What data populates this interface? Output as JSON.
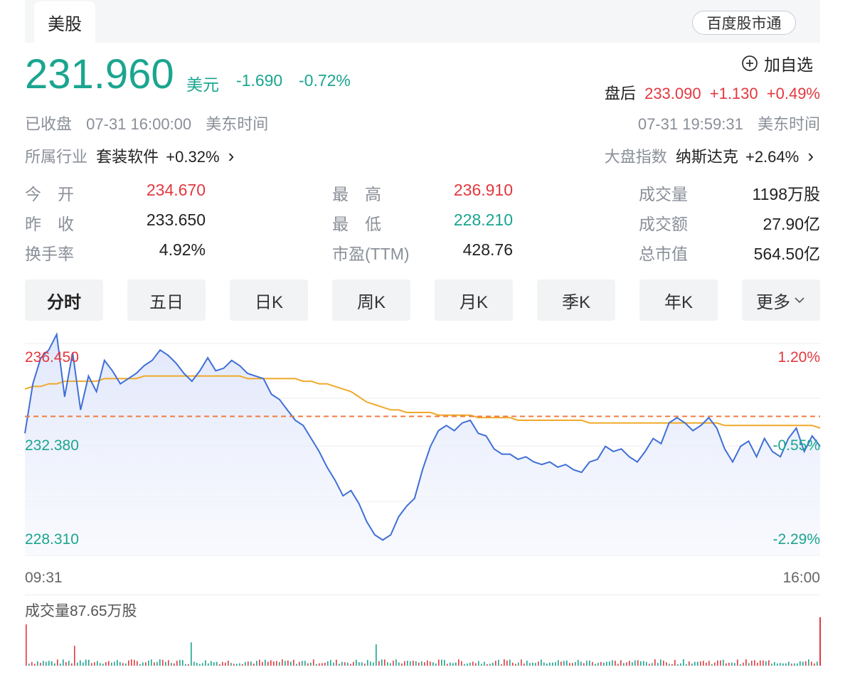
{
  "market_tab": "美股",
  "baidu_button": "百度股市通",
  "quote": {
    "price": "231.960",
    "currency": "美元",
    "change": "-1.690",
    "change_pct": "-0.72%"
  },
  "watchlist": {
    "icon": "plus-circle-icon",
    "label": "加自选"
  },
  "after_hours": {
    "label": "盘后",
    "price": "233.090",
    "change": "+1.130",
    "change_pct": "+0.49%"
  },
  "status": {
    "state": "已收盘",
    "time": "07-31 16:00:00",
    "tz": "美东时间"
  },
  "after_time": {
    "time": "07-31 19:59:31",
    "tz": "美东时间"
  },
  "industry": {
    "label": "所属行业",
    "name": "套装软件",
    "change": "+0.32%",
    "chevron": "›"
  },
  "index": {
    "label": "大盘指数",
    "name": "纳斯达克",
    "change": "+2.64%",
    "chevron": "›"
  },
  "stats": [
    [
      {
        "label": "今　开",
        "value": "234.670",
        "color": "red"
      },
      {
        "label": "最　高",
        "value": "236.910",
        "color": "red"
      },
      {
        "label": "成交量",
        "value": "1198万股",
        "color": "dark"
      }
    ],
    [
      {
        "label": "昨　收",
        "value": "233.650",
        "color": "dark"
      },
      {
        "label": "最　低",
        "value": "228.210",
        "color": "green"
      },
      {
        "label": "成交额",
        "value": "27.90亿",
        "color": "dark"
      }
    ],
    [
      {
        "label": "换手率",
        "value": "4.92%",
        "color": "dark"
      },
      {
        "label": "市盈(TTM)",
        "value": "428.76",
        "color": "dark"
      },
      {
        "label": "总市值",
        "value": "564.50亿",
        "color": "dark"
      }
    ]
  ],
  "periods": [
    "分时",
    "五日",
    "日K",
    "周K",
    "月K",
    "季K",
    "年K",
    "更多"
  ],
  "active_period": "分时",
  "volume_label": "成交量87.65万股",
  "colors": {
    "up": "#e2383f",
    "down": "#1aa58f",
    "price_line": "#3f6fd6",
    "avg_line": "#f0a92a",
    "prev_close": "#f07b3f"
  },
  "chart_data": {
    "type": "line",
    "x_start": "09:31",
    "x_end": "16:00",
    "y_labels": {
      "top": "236.450",
      "mid": "232.380",
      "bottom": "228.310"
    },
    "pct_labels": {
      "top": "1.20%",
      "mid": "-0.55%",
      "bottom": "-2.29%"
    },
    "prev_close": 233.65,
    "ylim": [
      228.31,
      236.45
    ],
    "series": [
      {
        "values": [
          233.0,
          234.9,
          235.9,
          236.2,
          236.8,
          234.4,
          236.1,
          233.9,
          235.2,
          234.6,
          235.8,
          235.4,
          234.9,
          235.1,
          235.3,
          235.6,
          235.8,
          236.2,
          236.0,
          235.7,
          235.3,
          235.0,
          235.4,
          235.9,
          235.4,
          235.5,
          235.8,
          235.6,
          235.3,
          235.2,
          235.1,
          234.5,
          234.3,
          233.9,
          233.5,
          233.3,
          232.8,
          232.3,
          231.7,
          231.2,
          230.6,
          230.8,
          230.3,
          229.6,
          229.1,
          228.9,
          229.1,
          229.8,
          230.2,
          230.5,
          231.6,
          232.5,
          233.1,
          233.3,
          233.1,
          233.4,
          233.5,
          233.0,
          232.9,
          232.4,
          232.2,
          232.2,
          232.0,
          232.1,
          231.9,
          231.8,
          231.9,
          231.7,
          231.8,
          231.6,
          231.5,
          231.9,
          232.0,
          232.5,
          232.3,
          232.4,
          232.1,
          231.9,
          232.3,
          232.8,
          232.6,
          233.4,
          233.6,
          233.4,
          233.1,
          233.3,
          233.6,
          233.2,
          232.4,
          231.9,
          232.5,
          232.7,
          232.1,
          232.8,
          232.3,
          232.1,
          232.8,
          233.2,
          232.3,
          232.9,
          232.5
        ]
      },
      {
        "values": [
          234.7,
          234.8,
          234.8,
          234.9,
          234.9,
          235.0,
          235.0,
          235.0,
          235.0,
          235.0,
          235.1,
          235.1,
          235.1,
          235.1,
          235.1,
          235.2,
          235.2,
          235.2,
          235.2,
          235.2,
          235.2,
          235.2,
          235.2,
          235.2,
          235.2,
          235.2,
          235.2,
          235.2,
          235.1,
          235.1,
          235.1,
          235.1,
          235.1,
          235.1,
          235.1,
          235.0,
          235.0,
          234.9,
          234.9,
          234.8,
          234.7,
          234.6,
          234.4,
          234.2,
          234.1,
          234.0,
          233.9,
          233.9,
          233.8,
          233.8,
          233.8,
          233.8,
          233.7,
          233.7,
          233.7,
          233.7,
          233.7,
          233.6,
          233.6,
          233.6,
          233.6,
          233.6,
          233.5,
          233.5,
          233.5,
          233.5,
          233.5,
          233.5,
          233.5,
          233.5,
          233.5,
          233.4,
          233.4,
          233.4,
          233.4,
          233.4,
          233.4,
          233.4,
          233.4,
          233.4,
          233.4,
          233.4,
          233.4,
          233.4,
          233.4,
          233.4,
          233.4,
          233.4,
          233.3,
          233.3,
          233.3,
          233.3,
          233.3,
          233.3,
          233.3,
          233.3,
          233.3,
          233.3,
          233.3,
          233.3,
          233.2
        ]
      }
    ]
  }
}
